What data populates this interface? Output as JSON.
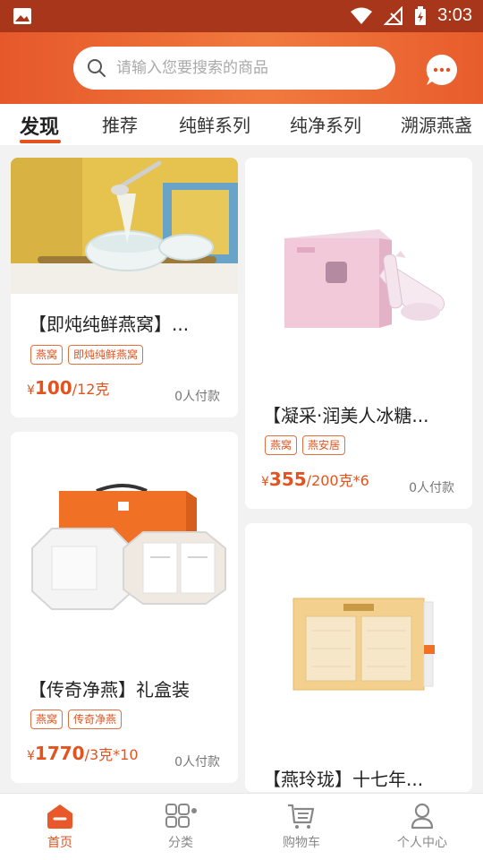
{
  "status_bar": {
    "time": "3:03"
  },
  "search": {
    "placeholder": "请输入您要搜索的商品"
  },
  "tabs": [
    {
      "label": "发现"
    },
    {
      "label": "推荐"
    },
    {
      "label": "纯鲜系列"
    },
    {
      "label": "纯净系列"
    },
    {
      "label": "溯源燕盏"
    }
  ],
  "products": [
    {
      "title": "【即炖纯鲜燕窝】...",
      "tags": [
        "燕窝",
        "即炖纯鲜燕窝"
      ],
      "currency": "¥",
      "price": "100",
      "unit": "/12克",
      "paid": "0人付款"
    },
    {
      "title": "【凝采·润美人冰糖...",
      "tags": [
        "燕窝",
        "燕安居"
      ],
      "currency": "¥",
      "price": "355",
      "unit": "/200克*6",
      "paid": "0人付款"
    },
    {
      "title": "【传奇净燕】礼盒装",
      "tags": [
        "燕窝",
        "传奇净燕"
      ],
      "currency": "¥",
      "price": "1770",
      "unit": "/3克*10",
      "paid": "0人付款"
    },
    {
      "title": "【燕玲珑】十七年..."
    }
  ],
  "bottom_nav": [
    {
      "label": "首页",
      "icon": "home-icon"
    },
    {
      "label": "分类",
      "icon": "category-icon"
    },
    {
      "label": "购物车",
      "icon": "cart-icon"
    },
    {
      "label": "个人中心",
      "icon": "user-icon"
    }
  ],
  "colors": {
    "accent": "#e2531f",
    "header": "#ef7a3e",
    "statusbar": "#a8361a"
  }
}
